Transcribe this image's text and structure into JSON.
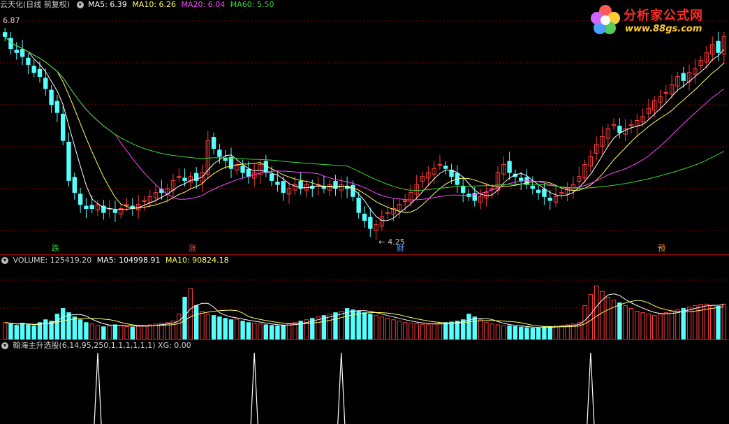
{
  "header": {
    "stock_title": "云天化(日线 前复权)",
    "ma5": "MA5: 6.39",
    "ma10": "MA10: 6.26",
    "ma20": "MA20: 6.04",
    "ma60": "MA60: 5.50"
  },
  "volume_header": {
    "volume": "VOLUME: 125419.20",
    "ma5": "MA5: 104998.91",
    "ma10": "MA10: 90824.18"
  },
  "indicator_header": {
    "label": "翰海主升选股(6,14,95,250,1,1,1,1,1,1) XG: 0.00"
  },
  "logo": {
    "title": "分析家公式网",
    "url": "www.88gs.com"
  },
  "annotations": {
    "high_label": "6.87",
    "low_label": "4.25"
  },
  "signals": [
    {
      "text": "跌",
      "color": "#2ecc40"
    },
    {
      "text": "涨",
      "color": "#ff4d4d"
    },
    {
      "text": "财",
      "color": "#5aa0ff"
    },
    {
      "text": "预",
      "color": "#ff9933"
    }
  ],
  "colors": {
    "up": "#ff3c3c",
    "down": "#54ffff",
    "ma5": "#ffffff",
    "ma10": "#ffff66",
    "ma20": "#ff44ff",
    "ma60": "#33dd33",
    "grid": "#8a0000",
    "indicator": "#ffffff"
  },
  "chart_data": [
    {
      "type": "candlestick",
      "name": "price",
      "ylim": [
        4.1,
        7.0
      ],
      "x_count": 125,
      "close": [
        6.7,
        6.55,
        6.5,
        6.45,
        6.35,
        6.25,
        6.2,
        6.05,
        5.85,
        5.75,
        5.4,
        4.9,
        4.75,
        4.6,
        4.55,
        4.55,
        4.6,
        4.5,
        4.55,
        4.5,
        4.55,
        4.6,
        4.55,
        4.6,
        4.65,
        4.7,
        4.75,
        4.75,
        4.8,
        4.9,
        4.95,
        4.9,
        4.95,
        4.9,
        5.0,
        5.4,
        5.3,
        5.2,
        5.15,
        5.05,
        5.1,
        5.0,
        4.95,
        5.0,
        5.1,
        5.0,
        4.9,
        4.85,
        4.75,
        4.8,
        4.85,
        4.8,
        4.85,
        4.8,
        4.85,
        4.8,
        4.85,
        4.8,
        4.85,
        4.8,
        4.7,
        4.5,
        4.4,
        4.3,
        4.35,
        4.45,
        4.5,
        4.55,
        4.6,
        4.65,
        4.75,
        4.85,
        4.95,
        5.0,
        5.05,
        5.1,
        5.05,
        4.95,
        4.85,
        4.75,
        4.7,
        4.65,
        4.7,
        4.75,
        4.8,
        5.0,
        5.1,
        5.0,
        4.95,
        4.9,
        4.85,
        4.8,
        4.75,
        4.7,
        4.65,
        4.7,
        4.75,
        4.8,
        4.85,
        4.95,
        5.1,
        5.2,
        5.35,
        5.45,
        5.55,
        5.6,
        5.5,
        5.55,
        5.6,
        5.65,
        5.7,
        5.8,
        5.9,
        5.95,
        6.0,
        6.1,
        6.2,
        6.15,
        6.25,
        6.3,
        6.4,
        6.5,
        6.6,
        6.5,
        6.7
      ]
    },
    {
      "type": "bar",
      "name": "volume",
      "x_count": 125,
      "ylim": [
        0,
        260000
      ],
      "values": [
        60000,
        55000,
        50000,
        58000,
        52000,
        48000,
        60000,
        70000,
        65000,
        90000,
        110000,
        95000,
        80000,
        70000,
        60000,
        55000,
        50000,
        45000,
        48000,
        52000,
        50000,
        46000,
        44000,
        47000,
        50000,
        52000,
        55000,
        58000,
        60000,
        65000,
        90000,
        150000,
        180000,
        120000,
        100000,
        90000,
        85000,
        80000,
        75000,
        70000,
        72000,
        65000,
        60000,
        58000,
        55000,
        52000,
        50000,
        48000,
        50000,
        55000,
        60000,
        65000,
        70000,
        75000,
        80000,
        85000,
        90000,
        95000,
        100000,
        110000,
        105000,
        100000,
        95000,
        90000,
        85000,
        80000,
        75000,
        70000,
        65000,
        60000,
        58000,
        56000,
        54000,
        52000,
        55000,
        58000,
        60000,
        62000,
        65000,
        70000,
        90000,
        80000,
        70000,
        60000,
        55000,
        52000,
        50000,
        48000,
        46000,
        44000,
        42000,
        40000,
        42000,
        44000,
        46000,
        48000,
        50000,
        52000,
        55000,
        60000,
        120000,
        160000,
        190000,
        170000,
        150000,
        140000,
        130000,
        120000,
        110000,
        100000,
        95000,
        90000,
        85000,
        90000,
        95000,
        100000,
        105000,
        110000,
        115000,
        120000,
        125000,
        125419,
        120000,
        118000,
        125419
      ]
    },
    {
      "type": "line",
      "name": "XG",
      "x_count": 125,
      "ylim": [
        0,
        1
      ],
      "spikes_at": [
        16,
        43,
        58,
        101
      ],
      "value_last": 0.0
    }
  ]
}
